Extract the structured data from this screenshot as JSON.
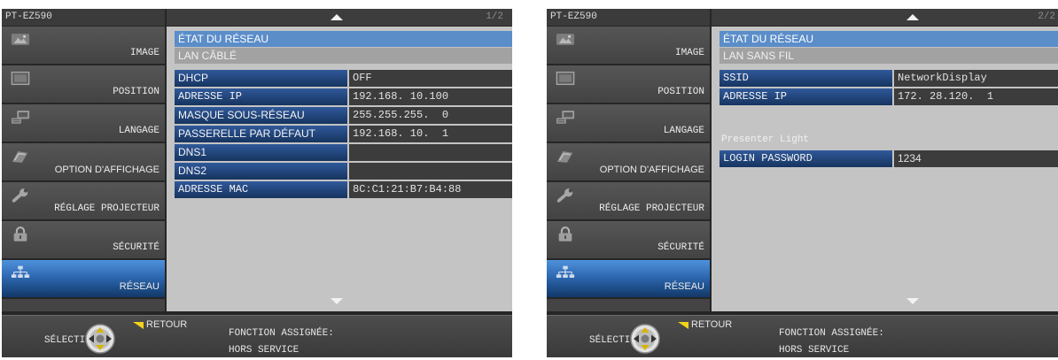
{
  "panels": [
    {
      "model": "PT-EZ590",
      "page": "1/2",
      "menu": [
        {
          "label": "IMAGE",
          "icon": "image-icon"
        },
        {
          "label": "POSITION",
          "icon": "position-icon"
        },
        {
          "label": "LANGAGE",
          "icon": "language-icon"
        },
        {
          "label": "OPTION D'AFFICHAGE",
          "icon": "display-option-icon"
        },
        {
          "label": "RÉGLAGE PROJECTEUR",
          "icon": "projector-settings-icon"
        },
        {
          "label": "SÉCURITÉ",
          "icon": "lock-icon"
        },
        {
          "label": "RÉSEAU",
          "icon": "network-icon",
          "selected": true
        }
      ],
      "section_title": "ÉTAT DU RÉSEAU",
      "subsection_title": "LAN CÂBLÉ",
      "rows": [
        {
          "label": "DHCP",
          "value": "OFF"
        },
        {
          "label": "ADRESSE IP",
          "value": "192.168. 10.100"
        },
        {
          "label": "MASQUE SOUS-RÉSEAU",
          "value": "255.255.255.  0"
        },
        {
          "label": "PASSERELLE PAR DÉFAUT",
          "value": "192.168. 10.  1"
        },
        {
          "label": "DNS1"
        },
        {
          "label": "DNS2"
        },
        {
          "label": "ADRESSE MAC",
          "value": "8C:C1:21:B7:B4:88"
        }
      ],
      "footer": {
        "select_label": "SÉLECTION",
        "return_label": "RETOUR",
        "assigned_function_label": "FONCTION ASSIGNÉE:",
        "assigned_function_value": "HORS SERVICE"
      }
    },
    {
      "model": "PT-EZ590",
      "page": "2/2",
      "menu": [
        {
          "label": "IMAGE",
          "icon": "image-icon"
        },
        {
          "label": "POSITION",
          "icon": "position-icon"
        },
        {
          "label": "LANGAGE",
          "icon": "language-icon"
        },
        {
          "label": "OPTION D'AFFICHAGE",
          "icon": "display-option-icon"
        },
        {
          "label": "RÉGLAGE PROJECTEUR",
          "icon": "projector-settings-icon"
        },
        {
          "label": "SÉCURITÉ",
          "icon": "lock-icon"
        },
        {
          "label": "RÉSEAU",
          "icon": "network-icon",
          "selected": true
        }
      ],
      "section_title": "ÉTAT DU RÉSEAU",
      "subsection_title": "LAN SANS FIL",
      "rows": [
        {
          "label": "SSID",
          "value": "NetworkDisplay"
        },
        {
          "label": "ADRESSE IP",
          "value": "172. 28.120.  1"
        }
      ],
      "presenter_title": "Presenter Light",
      "presenter_rows": [
        {
          "label": "LOGIN PASSWORD",
          "value": "1234"
        }
      ],
      "footer": {
        "select_label": "SÉLECTION",
        "return_label": "RETOUR",
        "assigned_function_label": "FONCTION ASSIGNÉE:",
        "assigned_function_value": "HORS SERVICE"
      }
    }
  ],
  "colors": {
    "section_blue": "#5b8dc9",
    "selected_menu_blue": "#2d68b0",
    "label_cell_blue": "#16345f",
    "value_cell_gray": "#3c3c3c",
    "content_background": "#c4c4c4",
    "return_arrow_yellow": "#f2d21b"
  }
}
